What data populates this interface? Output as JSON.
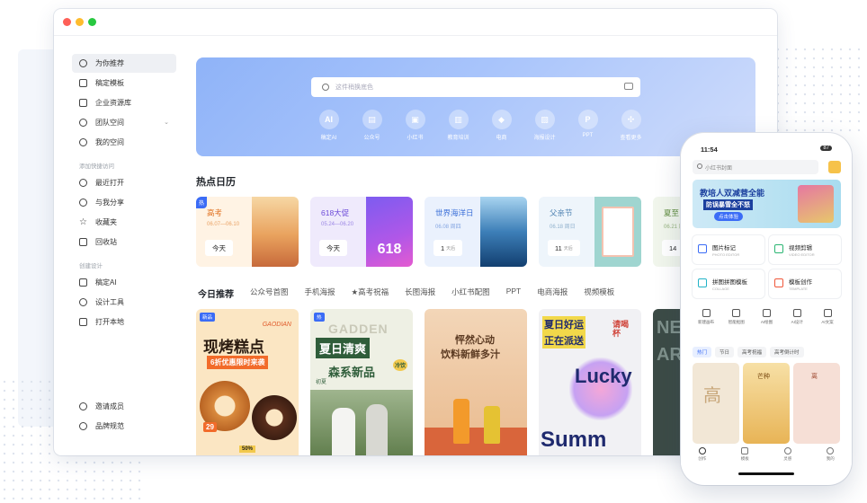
{
  "sidebar": {
    "items": [
      {
        "label": "为你推荐",
        "icon": "compass-icon"
      },
      {
        "label": "稿定模板",
        "icon": "template-icon"
      },
      {
        "label": "企业资源库",
        "icon": "folder-icon"
      },
      {
        "label": "团队空间",
        "icon": "team-icon"
      },
      {
        "label": "我的空间",
        "icon": "user-icon"
      }
    ],
    "section1": "添加快捷访问",
    "items2": [
      {
        "label": "最近打开",
        "icon": "clock-icon"
      },
      {
        "label": "与我分享",
        "icon": "share-icon"
      },
      {
        "label": "收藏夹",
        "icon": "star-icon"
      },
      {
        "label": "回收站",
        "icon": "trash-icon"
      }
    ],
    "section2": "创建设计",
    "items3": [
      {
        "label": "稿定AI",
        "icon": "ai-icon"
      },
      {
        "label": "设计工具",
        "icon": "design-tool-icon"
      },
      {
        "label": "打开本地",
        "icon": "open-local-icon"
      }
    ],
    "bottom": [
      {
        "label": "邀请成员",
        "icon": "invite-icon"
      },
      {
        "label": "品牌规范",
        "icon": "brand-icon"
      }
    ]
  },
  "banner": {
    "search_placeholder": "这件稍换底色",
    "categories": [
      {
        "label": "稿定AI",
        "glyph": "AI"
      },
      {
        "label": "公众号",
        "glyph": "▤"
      },
      {
        "label": "小红书",
        "glyph": "▣"
      },
      {
        "label": "教育培训",
        "glyph": "▥"
      },
      {
        "label": "电商",
        "glyph": "◆"
      },
      {
        "label": "海报设计",
        "glyph": "▧"
      },
      {
        "label": "PPT",
        "glyph": "P"
      },
      {
        "label": "查看更多",
        "glyph": "✣"
      }
    ]
  },
  "hot_calendar": {
    "title": "热点日历",
    "cards": [
      {
        "badge": "热",
        "title": "高考",
        "dates": "06.07—06.10",
        "button": "今天",
        "bg": "#fff4e6",
        "color": "#e0701f"
      },
      {
        "badge": "",
        "title": "618大促",
        "dates": "05.24—06.20",
        "button": "今天",
        "bg": "#efeafc",
        "color": "#6b49d8"
      },
      {
        "badge": "",
        "title": "世界海洋日",
        "dates": "06.08 周四",
        "button": "1",
        "button_suffix": "天后",
        "bg": "#eaf1fd",
        "color": "#3a6fd8"
      },
      {
        "badge": "",
        "title": "父亲节",
        "dates": "06.18 周日",
        "button": "11",
        "button_suffix": "天后",
        "bg": "#eef5fb",
        "color": "#4a7fb0"
      },
      {
        "badge": "",
        "title": "夏至",
        "dates": "06.21 周",
        "button": "14",
        "button_suffix": "",
        "bg": "#f1f6ec",
        "color": "#5c8a3a"
      }
    ]
  },
  "today": {
    "title": "今日推荐",
    "tabs": [
      "公众号首图",
      "手机海报",
      "★高考祝福",
      "长图海报",
      "小红书配图",
      "PPT",
      "电商海报",
      "视频模板"
    ]
  },
  "cards": [
    {
      "badge": "新品",
      "t1": "GAODIAN",
      "t2": "现烤糕点",
      "t3": "6折优惠限时来袭",
      "t4": "29",
      "t5": "50%"
    },
    {
      "badge": "热",
      "t1": "GADDEN",
      "t2": "夏日清爽",
      "t3": "森系新品",
      "t4": "冷饮",
      "t5": "初夏"
    },
    {
      "badge": "",
      "t1": "怦然心动",
      "t2": "饮料新鲜多汁",
      "t3": "",
      "t4": "",
      "t5": ""
    },
    {
      "badge": "",
      "t1": "夏日好运",
      "t2": "正在派送",
      "t3": "Lucky",
      "t4": "Summ",
      "t5": "请喝杯"
    },
    {
      "badge": "",
      "t1": "NEW",
      "t2": "AR",
      "t3": "",
      "t4": "",
      "t5": ""
    }
  ],
  "phone": {
    "time": "11:54",
    "battery": "87",
    "search_placeholder": "小红书封面",
    "banner_t1": "教培人双减营全能",
    "banner_t2": "防误暴雪全不怒",
    "banner_btn": "点击体验",
    "tools": [
      {
        "label": "图片标记",
        "sub": "PHOTO EDITOR"
      },
      {
        "label": "视频剪辑",
        "sub": "VIDEO EDITOR"
      },
      {
        "label": "拼图拼图模板",
        "sub": "COLLAGE"
      },
      {
        "label": "模板创作",
        "sub": "TEMPLATE"
      }
    ],
    "quick": [
      "新建画布",
      "智能抠图",
      "AI绘图",
      "AI设计",
      "AI文案"
    ],
    "chips": [
      "热门",
      "节日",
      "高考祝福",
      "高考倒计时"
    ],
    "tiles": [
      "高",
      "芒种",
      "离"
    ],
    "nav": [
      "创作",
      "模板",
      "灵感",
      "我的"
    ]
  },
  "colors": {
    "accent": "#3b6cf6",
    "banner": "#9bbcfa",
    "text": "#1f2329"
  }
}
